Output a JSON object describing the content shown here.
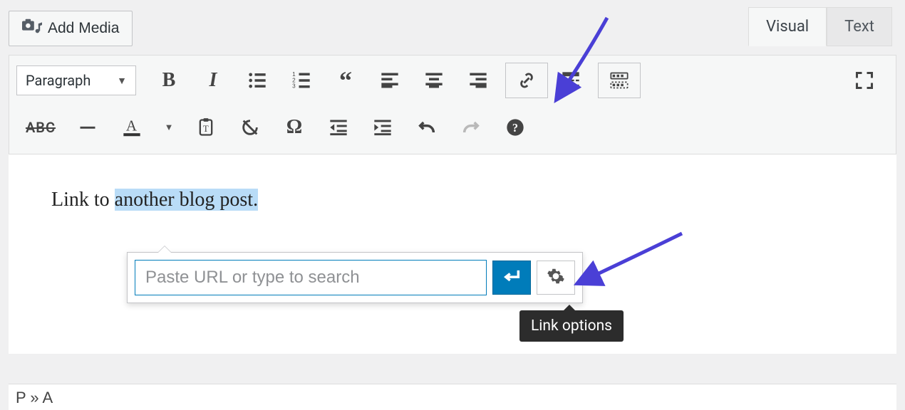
{
  "top": {
    "add_media_label": "Add Media"
  },
  "tabs": {
    "visual": "Visual",
    "text": "Text"
  },
  "format_dropdown": "Paragraph",
  "content": {
    "before_sel": "Link to ",
    "selected": "another blog post.",
    "after_sel": ""
  },
  "link_popup": {
    "placeholder": "Paste URL or type to search"
  },
  "tooltip": "Link options",
  "status_path": "P » A"
}
